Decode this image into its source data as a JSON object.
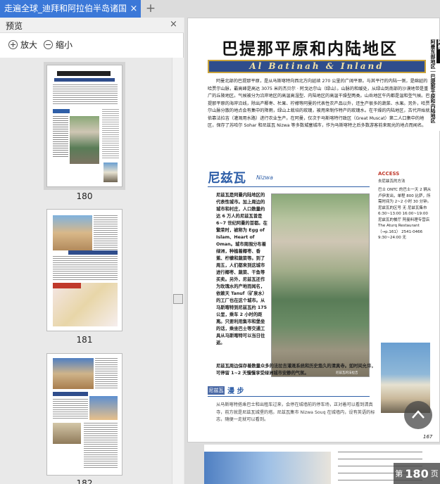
{
  "tab": {
    "title": "走遍全球_迪拜和阿拉伯半岛诸国",
    "close": "×",
    "add": "+"
  },
  "sidebar": {
    "title": "预览",
    "close": "×",
    "zoom_in": "放大",
    "zoom_out": "缩小",
    "thumbnails": [
      {
        "page": "180"
      },
      {
        "page": "181"
      },
      {
        "page": "182"
      }
    ]
  },
  "page": {
    "title": "巴提那平原和内陆地区",
    "subtitle": "Al Batinah & Inland",
    "intro": "阿曼北部的巴提那平原，是从马斯喀特向西北方向延续 270 公里的广阔平原。与其平行的内陆一侧，是绵延的哈贾尔山脉，最高峰是高达 3075 米的杰贝尔 · 阿戈达尔山（绿山）。山脉的和缓处，从绿山到南部的沙漠地带是重广的丘陵地区。气候被分为沿岸地区的高温高湿型、内陆地区的高温干燥型两类。山岳地区午内都是温和型气候。巴提那平原的海岸沿线，除出产椰枣、杧果、柠檬等阿曼的代表性农产品以外，还生产很多的蔬菜、水果。另外，哈贾尔山脉分散的地点会有集中的降雨，绿山上栽培的玫瑰，被用来制作特产的玫瑰水。在干燥的内陆地区，古代开始就依靠法拉吉（灌溉用水路）进行农业生产。在阿曼，仅次于马斯喀特行政区（Great Muscat）第二人口集中的地区，保存了苏哈尔 Sohar 和尼兹瓦 Nizwa 等多数城塞城市，作为马斯喀特之后多数游客前来观光的地点而闻名。",
    "section_title": "尼兹瓦",
    "section_sub": "Nizwa",
    "body_text": "尼兹瓦是阿曼内陆地区的代表性城市。加上周边的城市和村庄，人口数量约达 6 万人的尼兹瓦曾是 6~7 世纪阿曼的首都。在繁荣时，被称为 Egg of Islam、Heart of Oman。城市周围分布着绿洲，种植着椰枣、香蕉、柠檬和蔬菜等。到了周五，人们都来到这城市进行椰枣、蔬菜、干鱼等买卖。另外，尼兹瓦还作为玫瑰水的产地而闻名，依赖天 Tanuf（矿泉水）的工厂也在这个城市。从马斯喀特到尼兹瓦约 175 公里，乘车 2 小时的距离。只要利用集市和堡垒的话，乘坐巴士等交通工具从马斯喀特可以当日往返。",
    "bottom_text": "尼兹瓦周边保存着数量众多的法拉吉灌溉系统和历史悠久的清真寺。如时间允许，可停留 1~2 天慢慢享受绿洲城市安静的气氛。",
    "photo_caption": "尼兹瓦的法拉吉",
    "walk_tag": "尼兹瓦",
    "walk_title": "漫 步",
    "walk_text": "从马斯喀特搭乘巴士和出租车过来，会停在城墙前的停车场，正对着可以看到清真寺，前方就是尼兹瓦城堡的塔。尼兹瓦集市 Nizwa Souq 在城墙内，设有英语的标志，随便一走就可以看到。",
    "access_label": "ACCESS",
    "access_sub": "去尼兹瓦的方法",
    "side_text": "巴士 ONTC 的巴士一天 2 辆从卢伊发出，单程 800 比萨，所需时间为 2~2 小时 30 分钟。尼兹瓦的区号 无 尼兹瓦集市 6:30~13:00 16:00~19:00 尼兹瓦的餐厅 阿曼料理专营店 The Aturq Restaurant（→p.161） 2541-0466 9:30~24:00 无",
    "side_tab": "阿曼",
    "side_tab_sub": "阿曼东部地区｜巴提那平原和内陆地区",
    "page_number": "167"
  },
  "page_indicator": {
    "prefix": "第",
    "number": "180",
    "suffix": "页"
  }
}
